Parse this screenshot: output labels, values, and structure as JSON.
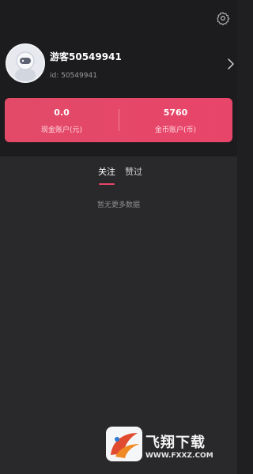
{
  "colors": {
    "background": "#1f1f21",
    "accent": "#e8456a",
    "card_gradient_start": "#e24a67",
    "card_gradient_end": "#e8456a",
    "muted_text": "#9a9a9e"
  },
  "header": {
    "settings_icon": "gear-icon"
  },
  "profile": {
    "avatar_icon": "astronaut-avatar",
    "name": "游客50549941",
    "id_text": "id: 50549941",
    "chevron_icon": "chevron-right-icon"
  },
  "accounts": [
    {
      "value": "0.0",
      "label": "现金账户(元)"
    },
    {
      "value": "5760",
      "label": "金币账户(币)"
    }
  ],
  "tabs": [
    {
      "label": "关注",
      "active": true
    },
    {
      "label": "赞过",
      "active": false
    }
  ],
  "empty_message": "暂无更多数据",
  "watermark": {
    "text": "飞翔下载",
    "url": "WWW.FXXZ.COM"
  }
}
